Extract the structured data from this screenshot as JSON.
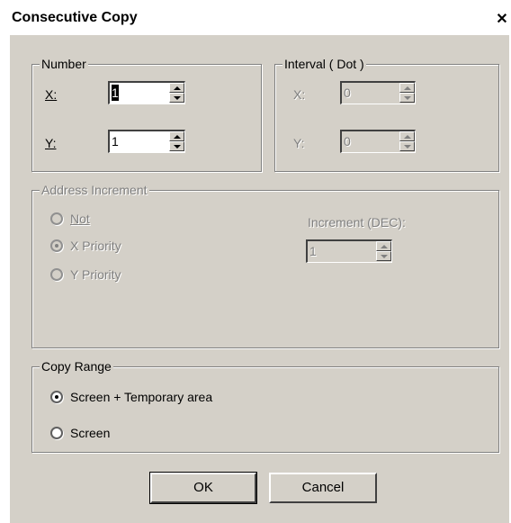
{
  "window": {
    "title": "Consecutive Copy",
    "close_glyph": "✕"
  },
  "number": {
    "legend": "Number",
    "x_label": "X:",
    "x_value": "1",
    "y_label": "Y:",
    "y_value": "1"
  },
  "interval": {
    "legend": "Interval ( Dot )",
    "x_label": "X:",
    "x_value": "0",
    "y_label": "Y:",
    "y_value": "0"
  },
  "address": {
    "legend": "Address Increment",
    "options": [
      "Not",
      "X Priority",
      "Y Priority"
    ],
    "selected": "X Priority",
    "increment_label": "Increment (DEC):",
    "increment_value": "1"
  },
  "copy_range": {
    "legend": "Copy Range",
    "options": [
      "Screen + Temporary area",
      "Screen"
    ],
    "selected": "Screen + Temporary area"
  },
  "buttons": {
    "ok": "OK",
    "cancel": "Cancel"
  },
  "icons": {
    "close": "close-icon",
    "spin_up": "up-arrow-icon",
    "spin_down": "down-arrow-icon"
  }
}
